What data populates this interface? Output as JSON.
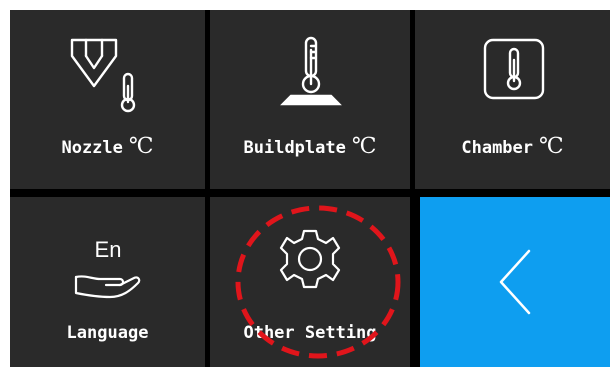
{
  "tiles": {
    "nozzle": {
      "label": "Nozzle",
      "unit": "℃",
      "icon": "nozzle-thermometer-icon"
    },
    "buildplate": {
      "label": "Buildplate",
      "unit": "℃",
      "icon": "buildplate-thermometer-icon"
    },
    "chamber": {
      "label": "Chamber",
      "unit": "℃",
      "icon": "chamber-thermometer-icon"
    },
    "language": {
      "label": "Language",
      "icon_text": "En",
      "icon": "language-hand-icon"
    },
    "other_setting": {
      "label": "Other Setting",
      "icon": "gear-icon"
    },
    "back": {
      "icon": "chevron-left-icon"
    }
  },
  "colors": {
    "tile_background": "#2a2a2a",
    "grid_background": "#000000",
    "back_tile": "#0e9ef0",
    "text": "#ffffff",
    "highlight_circle": "#e0151b"
  }
}
